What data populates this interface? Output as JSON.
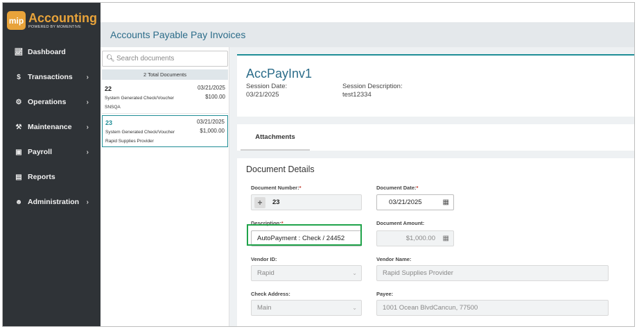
{
  "app": {
    "logo_badge": "mip",
    "logo_title": "Accounting",
    "logo_subtitle": "POWERED BY MOMENTIVE",
    "accent_color": "#e8a33a",
    "sidebar_color": "#2f3337"
  },
  "sidebar": {
    "items": [
      {
        "label": "Dashboard",
        "icon": "line-chart-icon",
        "has_submenu": false
      },
      {
        "label": "Transactions",
        "icon": "dollar-icon",
        "has_submenu": true
      },
      {
        "label": "Operations",
        "icon": "gears-icon",
        "has_submenu": true
      },
      {
        "label": "Maintenance",
        "icon": "wrench-icon",
        "has_submenu": true
      },
      {
        "label": "Payroll",
        "icon": "id-card-icon",
        "has_submenu": true
      },
      {
        "label": "Reports",
        "icon": "document-icon",
        "has_submenu": false
      },
      {
        "label": "Administration",
        "icon": "users-icon",
        "has_submenu": true
      }
    ]
  },
  "page": {
    "title": "Accounts Payable Pay Invoices"
  },
  "doc_list": {
    "search_placeholder": "Search documents",
    "total_label": "2 Total Documents",
    "items": [
      {
        "number": "22",
        "date": "03/21/2025",
        "description": "System Generated Check/Voucher",
        "amount": "$100.00",
        "vendor": "SNSQA",
        "selected": false
      },
      {
        "number": "23",
        "date": "03/21/2025",
        "description": "System Generated Check/Voucher",
        "amount": "$1,000.00",
        "vendor": "Rapid Supplies Provider",
        "selected": true
      }
    ]
  },
  "session": {
    "name": "AccPayInv1",
    "date_label": "Session Date:",
    "date_value": "03/21/2025",
    "description_label": "Session Description:",
    "description_value": "test12334"
  },
  "tabs": {
    "attachments": "Attachments"
  },
  "details": {
    "title": "Document Details",
    "document_number_label": "Document Number:",
    "document_number_value": "23",
    "document_date_label": "Document Date:",
    "document_date_value": "03/21/2025",
    "description_label": "Description:",
    "description_value": "AutoPayment : Check / 24452",
    "document_amount_label": "Document Amount:",
    "document_amount_value": "$1,000.00",
    "vendor_id_label": "Vendor ID:",
    "vendor_id_value": "Rapid",
    "vendor_name_label": "Vendor Name:",
    "vendor_name_value": "Rapid Supplies Provider",
    "check_address_label": "Check Address:",
    "check_address_value": "Main",
    "payee_label": "Payee:",
    "payee_value": "1001 Ocean BlvdCancun,  77500",
    "required_mark": "*",
    "highlight_color": "#1fa34a"
  }
}
